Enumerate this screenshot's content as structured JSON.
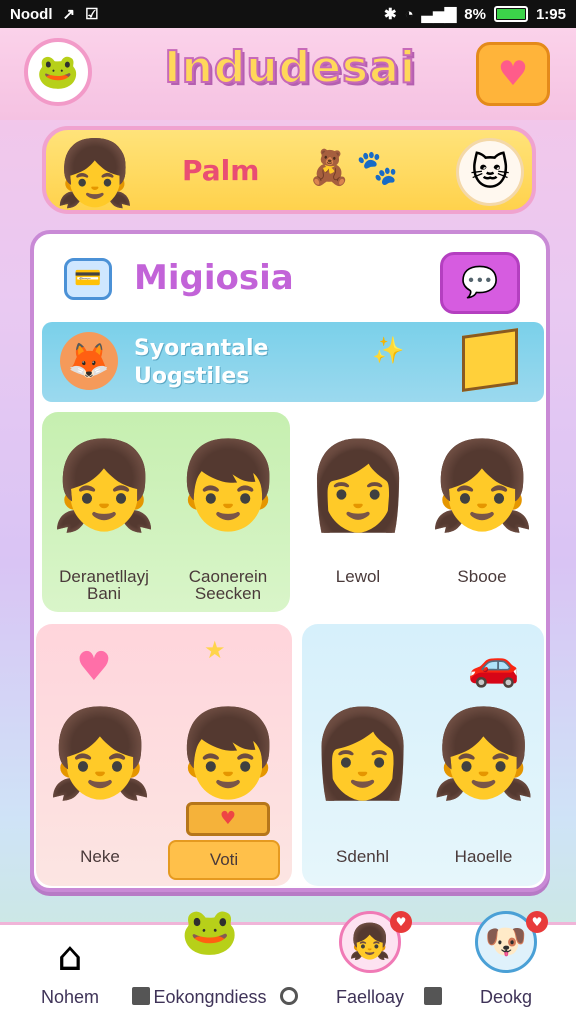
{
  "status_bar": {
    "carrier": "Noodl",
    "time": "1:95",
    "battery": "8%"
  },
  "header": {
    "title": "Indudesai"
  },
  "banner": {
    "label": "Palm"
  },
  "panel": {
    "title": "Migiosia",
    "info_line1": "Syorantale",
    "info_line2": "Uogstiles"
  },
  "cards": {
    "a": {
      "labels": [
        "Deranetllayj Bani",
        "Caonerein Seecken"
      ]
    },
    "b": {
      "labels": [
        "Lewol",
        "Sbooe"
      ]
    },
    "c": {
      "labels": [
        "Neke",
        "Voti"
      ]
    },
    "d": {
      "labels": [
        "Sdenhl",
        "Haoelle"
      ]
    }
  },
  "bottom_nav": {
    "items": [
      {
        "label": "Nohem"
      },
      {
        "label": "Eokongndiess"
      },
      {
        "label": "Faelloay"
      },
      {
        "label": "Deokg"
      }
    ]
  },
  "icons": {
    "avatar": "green-cat-avatar",
    "heart": "heart-icon",
    "chat": "chat-bubble-icon",
    "home": "home-icon"
  }
}
